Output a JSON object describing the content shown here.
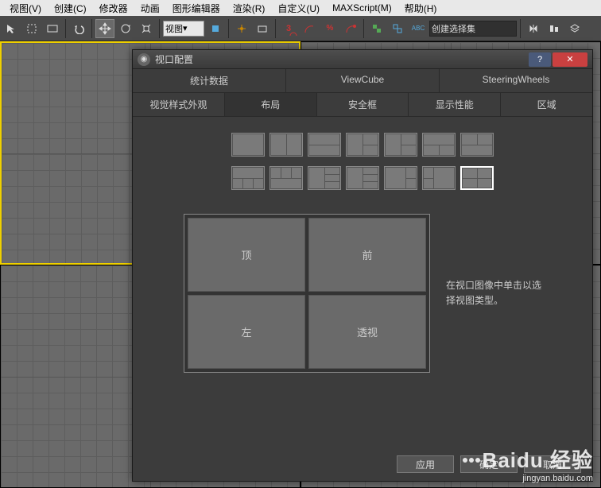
{
  "menubar": [
    "视图(V)",
    "创建(C)",
    "修改器",
    "动画",
    "图形编辑器",
    "渲染(R)",
    "自定义(U)",
    "MAXScript(M)",
    "帮助(H)"
  ],
  "toolbar": {
    "dropdown1": "视图",
    "dropdown2": "创建选择集"
  },
  "dialog": {
    "title": "视口配置",
    "tabs_row1": [
      "统计数据",
      "ViewCube",
      "SteeringWheels"
    ],
    "tabs_row2": [
      "视觉样式外观",
      "布局",
      "安全框",
      "显示性能",
      "区域"
    ],
    "active_tab": "布局",
    "preview_cells": [
      "顶",
      "前",
      "左",
      "透视"
    ],
    "hint": "在视口图像中单击以选择视图类型。",
    "buttons": [
      "应用",
      "确定",
      "取消"
    ]
  },
  "watermark": {
    "brand": "Baidu 经验",
    "url": "jingyan.baidu.com"
  }
}
